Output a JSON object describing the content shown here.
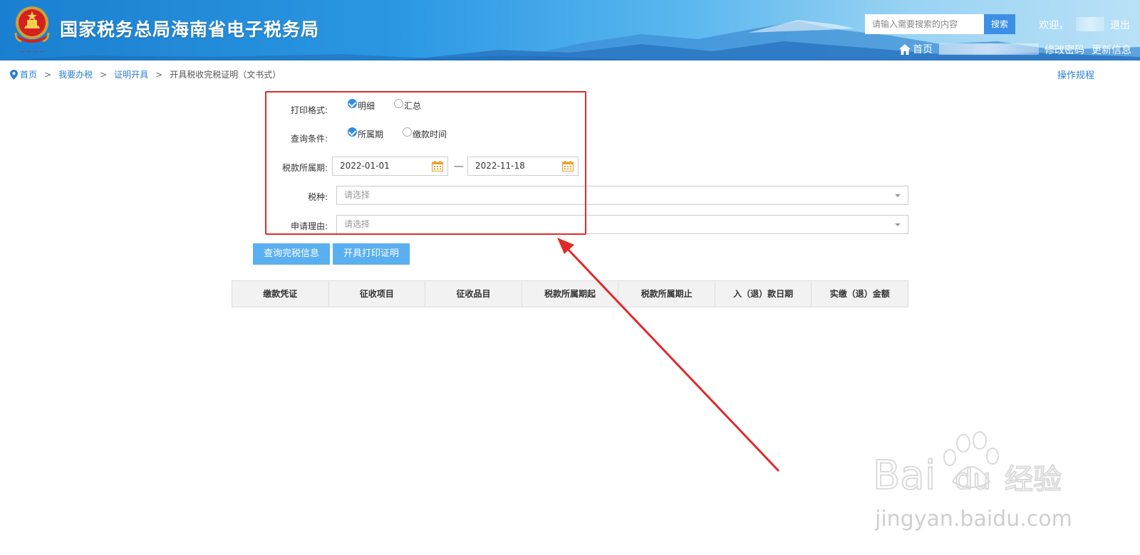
{
  "header": {
    "site_title": "国家税务总局海南省电子税务局",
    "search_placeholder": "请输入需要搜索的内容",
    "search_button": "搜索",
    "welcome": "欢迎，",
    "logout": "退出",
    "home": "首页",
    "change_password": "修改密码",
    "update_info": "更新信息",
    "colors": {
      "header_start": "#1a7fd0",
      "header_end": "#b9e1f6",
      "search_button": "#3d8ee8"
    }
  },
  "breadcrumb": {
    "items": [
      "首页",
      "我要办税",
      "证明开具",
      "开具税收完税证明（文书式）"
    ],
    "separator": ">",
    "operation_guide": "操作规程"
  },
  "form": {
    "print_format": {
      "label": "打印格式:",
      "options": [
        {
          "label": "明细",
          "checked": true
        },
        {
          "label": "汇总",
          "checked": false
        }
      ]
    },
    "query_condition": {
      "label": "查询条件:",
      "options": [
        {
          "label": "所属期",
          "checked": true
        },
        {
          "label": "缴款时间",
          "checked": false
        }
      ]
    },
    "tax_period": {
      "label": "税款所属期:",
      "start": "2022-01-01",
      "separator": "—",
      "end": "2022-11-18"
    },
    "tax_type": {
      "label": "税种:",
      "placeholder": "请选择"
    },
    "reason": {
      "label": "申请理由:",
      "placeholder": "请选择"
    }
  },
  "buttons": {
    "query": "查询完税信息",
    "print": "开具打印证明",
    "color": "#5aaff0"
  },
  "table": {
    "columns": [
      "缴款凭证",
      "征收项目",
      "征收品目",
      "税款所属期起",
      "税款所属期止",
      "入（退）款日期",
      "实缴（退）金额"
    ]
  },
  "annotation": {
    "color": "#e02a2a"
  },
  "watermark": {
    "brand": "Baidu",
    "suffix": "经验",
    "url": "jingyan.baidu.com"
  }
}
